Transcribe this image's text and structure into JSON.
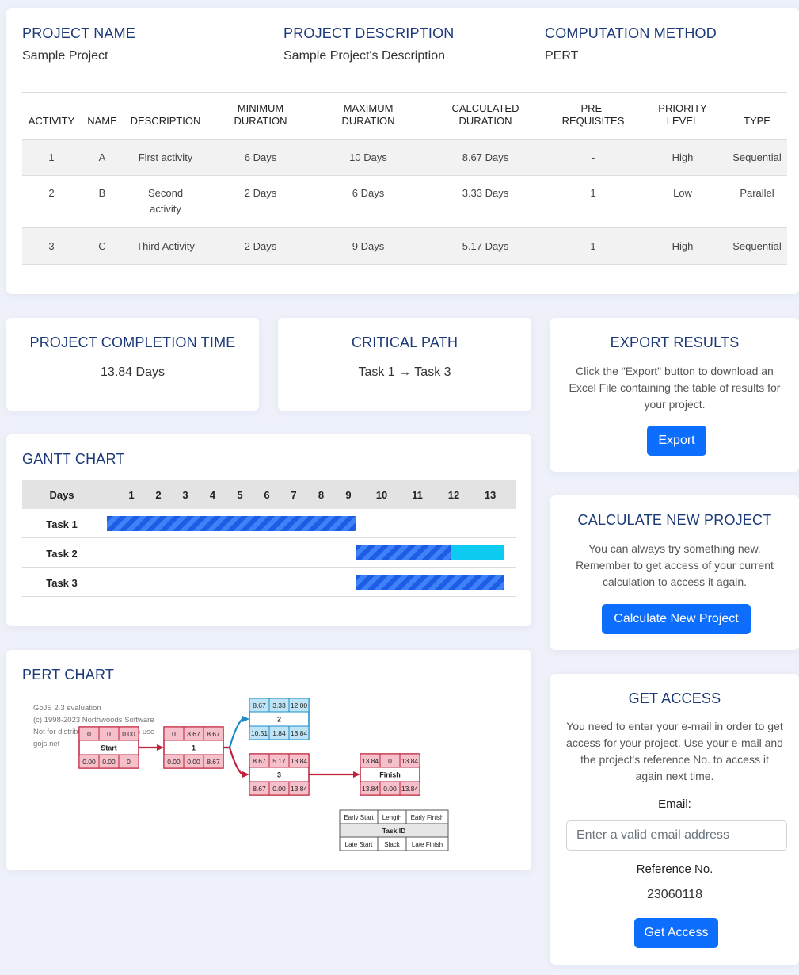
{
  "project": {
    "name_label": "PROJECT NAME",
    "name": "Sample Project",
    "desc_label": "PROJECT DESCRIPTION",
    "desc": "Sample Project's Description",
    "method_label": "COMPUTATION METHOD",
    "method": "PERT"
  },
  "table": {
    "headers": [
      "ACTIVITY",
      "NAME",
      "DESCRIPTION",
      "MINIMUM DURATION",
      "MAXIMUM DURATION",
      "CALCULATED DURATION",
      "PRE-REQUISITES",
      "PRIORITY LEVEL",
      "TYPE"
    ],
    "rows": [
      [
        "1",
        "A",
        "First activity",
        "6 Days",
        "10 Days",
        "8.67 Days",
        "-",
        "High",
        "Sequential"
      ],
      [
        "2",
        "B",
        "Second activity",
        "2 Days",
        "6 Days",
        "3.33 Days",
        "1",
        "Low",
        "Parallel"
      ],
      [
        "3",
        "C",
        "Third Activity",
        "2 Days",
        "9 Days",
        "5.17 Days",
        "1",
        "High",
        "Sequential"
      ]
    ]
  },
  "completion": {
    "title": "PROJECT COMPLETION TIME",
    "value": "13.84 Days"
  },
  "critical": {
    "title": "CRITICAL PATH",
    "value": "Task 1 → Task 3"
  },
  "export": {
    "title": "EXPORT RESULTS",
    "text": "Click the \"Export\" button to download an Excel File containing the table of results for your project.",
    "button": "Export"
  },
  "calc": {
    "title": "CALCULATE NEW PROJECT",
    "text": "You can always try something new. Remember to get access of your current calculation to access it again.",
    "button": "Calculate New Project"
  },
  "access": {
    "title": "GET ACCESS",
    "text": "You need to enter your e-mail in order to get access for your project. Use your e-mail and the project's reference No. to access it again next time.",
    "email_label": "Email:",
    "email_placeholder": "Enter a valid email address",
    "ref_label": "Reference No.",
    "ref_value": "23060118",
    "button": "Get Access"
  },
  "gantt": {
    "title": "GANTT CHART",
    "days_label": "Days",
    "days": [
      "1",
      "2",
      "3",
      "4",
      "5",
      "6",
      "7",
      "8",
      "9",
      "10",
      "11",
      "12",
      "13"
    ],
    "tasks": [
      {
        "label": "Task 1",
        "start": 0,
        "duration": 8.67,
        "slack": 0
      },
      {
        "label": "Task 2",
        "start": 8.67,
        "duration": 3.33,
        "slack": 1.84
      },
      {
        "label": "Task 3",
        "start": 8.67,
        "duration": 5.17,
        "slack": 0
      }
    ]
  },
  "pert": {
    "title": "PERT CHART",
    "watermark": [
      "GoJS 2.3 evaluation",
      "(c) 1998-2023 Northwoods Software",
      "Not for distribution or production use",
      "gojs.net"
    ],
    "nodes": [
      {
        "id": "Start",
        "es": "0",
        "len": "0",
        "ef": "0.00",
        "ls": "0.00",
        "slack": "0.00",
        "lf": "0",
        "critical": true
      },
      {
        "id": "1",
        "es": "0",
        "len": "8.67",
        "ef": "8.67",
        "ls": "0.00",
        "slack": "0.00",
        "lf": "8.67",
        "critical": true
      },
      {
        "id": "2",
        "es": "8.67",
        "len": "3.33",
        "ef": "12.00",
        "ls": "10.51",
        "slack": "1.84",
        "lf": "13.84",
        "critical": false
      },
      {
        "id": "3",
        "es": "8.67",
        "len": "5.17",
        "ef": "13.84",
        "ls": "8.67",
        "slack": "0.00",
        "lf": "13.84",
        "critical": true
      },
      {
        "id": "Finish",
        "es": "13.84",
        "len": "0",
        "ef": "13.84",
        "ls": "13.84",
        "slack": "0.00",
        "lf": "13.84",
        "critical": true
      }
    ],
    "legend": {
      "es": "Early Start",
      "len": "Length",
      "ef": "Early Finish",
      "id": "Task ID",
      "ls": "Late Start",
      "slack": "Slack",
      "lf": "Late Finish"
    },
    "colors": {
      "critical_fill": "#f6c0cb",
      "critical_stroke": "#c0203a",
      "normal_fill": "#bfe4f5",
      "normal_stroke": "#1a8cc8"
    }
  },
  "colors": {
    "accent": "#0d6efd",
    "heading": "#1c3a7a",
    "page_bg": "#eef1f9",
    "gantt_bar": "#2f6ff0",
    "gantt_slack": "#0dcaf0"
  }
}
